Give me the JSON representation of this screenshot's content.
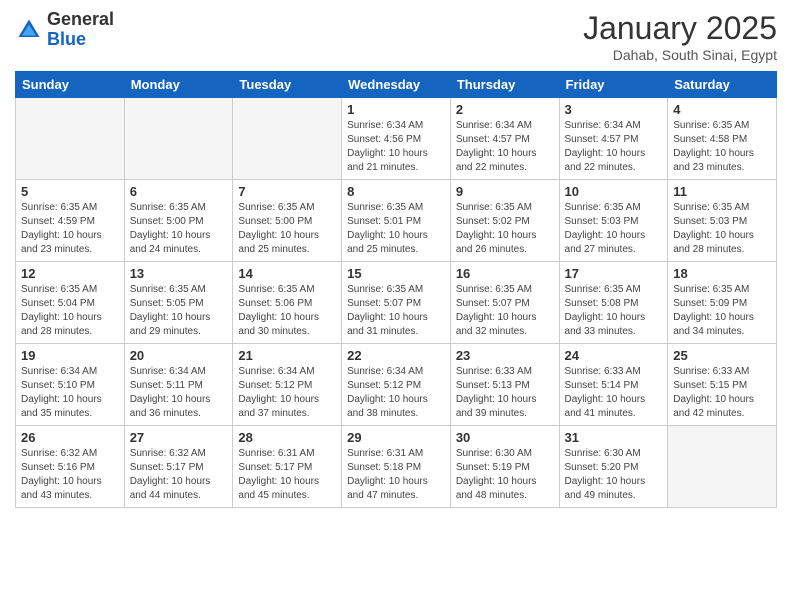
{
  "header": {
    "logo_general": "General",
    "logo_blue": "Blue",
    "month_title": "January 2025",
    "location": "Dahab, South Sinai, Egypt"
  },
  "days_of_week": [
    "Sunday",
    "Monday",
    "Tuesday",
    "Wednesday",
    "Thursday",
    "Friday",
    "Saturday"
  ],
  "weeks": [
    [
      {
        "day": "",
        "info": ""
      },
      {
        "day": "",
        "info": ""
      },
      {
        "day": "",
        "info": ""
      },
      {
        "day": "1",
        "info": "Sunrise: 6:34 AM\nSunset: 4:56 PM\nDaylight: 10 hours\nand 21 minutes."
      },
      {
        "day": "2",
        "info": "Sunrise: 6:34 AM\nSunset: 4:57 PM\nDaylight: 10 hours\nand 22 minutes."
      },
      {
        "day": "3",
        "info": "Sunrise: 6:34 AM\nSunset: 4:57 PM\nDaylight: 10 hours\nand 22 minutes."
      },
      {
        "day": "4",
        "info": "Sunrise: 6:35 AM\nSunset: 4:58 PM\nDaylight: 10 hours\nand 23 minutes."
      }
    ],
    [
      {
        "day": "5",
        "info": "Sunrise: 6:35 AM\nSunset: 4:59 PM\nDaylight: 10 hours\nand 23 minutes."
      },
      {
        "day": "6",
        "info": "Sunrise: 6:35 AM\nSunset: 5:00 PM\nDaylight: 10 hours\nand 24 minutes."
      },
      {
        "day": "7",
        "info": "Sunrise: 6:35 AM\nSunset: 5:00 PM\nDaylight: 10 hours\nand 25 minutes."
      },
      {
        "day": "8",
        "info": "Sunrise: 6:35 AM\nSunset: 5:01 PM\nDaylight: 10 hours\nand 25 minutes."
      },
      {
        "day": "9",
        "info": "Sunrise: 6:35 AM\nSunset: 5:02 PM\nDaylight: 10 hours\nand 26 minutes."
      },
      {
        "day": "10",
        "info": "Sunrise: 6:35 AM\nSunset: 5:03 PM\nDaylight: 10 hours\nand 27 minutes."
      },
      {
        "day": "11",
        "info": "Sunrise: 6:35 AM\nSunset: 5:03 PM\nDaylight: 10 hours\nand 28 minutes."
      }
    ],
    [
      {
        "day": "12",
        "info": "Sunrise: 6:35 AM\nSunset: 5:04 PM\nDaylight: 10 hours\nand 28 minutes."
      },
      {
        "day": "13",
        "info": "Sunrise: 6:35 AM\nSunset: 5:05 PM\nDaylight: 10 hours\nand 29 minutes."
      },
      {
        "day": "14",
        "info": "Sunrise: 6:35 AM\nSunset: 5:06 PM\nDaylight: 10 hours\nand 30 minutes."
      },
      {
        "day": "15",
        "info": "Sunrise: 6:35 AM\nSunset: 5:07 PM\nDaylight: 10 hours\nand 31 minutes."
      },
      {
        "day": "16",
        "info": "Sunrise: 6:35 AM\nSunset: 5:07 PM\nDaylight: 10 hours\nand 32 minutes."
      },
      {
        "day": "17",
        "info": "Sunrise: 6:35 AM\nSunset: 5:08 PM\nDaylight: 10 hours\nand 33 minutes."
      },
      {
        "day": "18",
        "info": "Sunrise: 6:35 AM\nSunset: 5:09 PM\nDaylight: 10 hours\nand 34 minutes."
      }
    ],
    [
      {
        "day": "19",
        "info": "Sunrise: 6:34 AM\nSunset: 5:10 PM\nDaylight: 10 hours\nand 35 minutes."
      },
      {
        "day": "20",
        "info": "Sunrise: 6:34 AM\nSunset: 5:11 PM\nDaylight: 10 hours\nand 36 minutes."
      },
      {
        "day": "21",
        "info": "Sunrise: 6:34 AM\nSunset: 5:12 PM\nDaylight: 10 hours\nand 37 minutes."
      },
      {
        "day": "22",
        "info": "Sunrise: 6:34 AM\nSunset: 5:12 PM\nDaylight: 10 hours\nand 38 minutes."
      },
      {
        "day": "23",
        "info": "Sunrise: 6:33 AM\nSunset: 5:13 PM\nDaylight: 10 hours\nand 39 minutes."
      },
      {
        "day": "24",
        "info": "Sunrise: 6:33 AM\nSunset: 5:14 PM\nDaylight: 10 hours\nand 41 minutes."
      },
      {
        "day": "25",
        "info": "Sunrise: 6:33 AM\nSunset: 5:15 PM\nDaylight: 10 hours\nand 42 minutes."
      }
    ],
    [
      {
        "day": "26",
        "info": "Sunrise: 6:32 AM\nSunset: 5:16 PM\nDaylight: 10 hours\nand 43 minutes."
      },
      {
        "day": "27",
        "info": "Sunrise: 6:32 AM\nSunset: 5:17 PM\nDaylight: 10 hours\nand 44 minutes."
      },
      {
        "day": "28",
        "info": "Sunrise: 6:31 AM\nSunset: 5:17 PM\nDaylight: 10 hours\nand 45 minutes."
      },
      {
        "day": "29",
        "info": "Sunrise: 6:31 AM\nSunset: 5:18 PM\nDaylight: 10 hours\nand 47 minutes."
      },
      {
        "day": "30",
        "info": "Sunrise: 6:30 AM\nSunset: 5:19 PM\nDaylight: 10 hours\nand 48 minutes."
      },
      {
        "day": "31",
        "info": "Sunrise: 6:30 AM\nSunset: 5:20 PM\nDaylight: 10 hours\nand 49 minutes."
      },
      {
        "day": "",
        "info": ""
      }
    ]
  ]
}
